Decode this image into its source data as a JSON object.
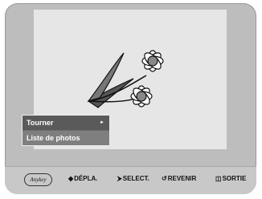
{
  "menu": {
    "items": [
      {
        "label": "Tourner",
        "submenu_indicator": "►",
        "selected": true
      },
      {
        "label": "Liste de photos",
        "selected": false
      }
    ]
  },
  "footer": {
    "anykey_label": "Anykey",
    "move_icon": "◆",
    "move_label": "DÉPLA.",
    "select_icon": "⮞",
    "select_label": "SELECT.",
    "return_icon": "↺",
    "return_label": "REVENIR",
    "exit_icon": "◫",
    "exit_label": "SORTIE"
  },
  "colors": {
    "screen_background": "#bdbdbd",
    "photo_background": "#e6e6e6",
    "menu_background": "#7f7f7f",
    "menu_selected": "#5a5a5a"
  }
}
